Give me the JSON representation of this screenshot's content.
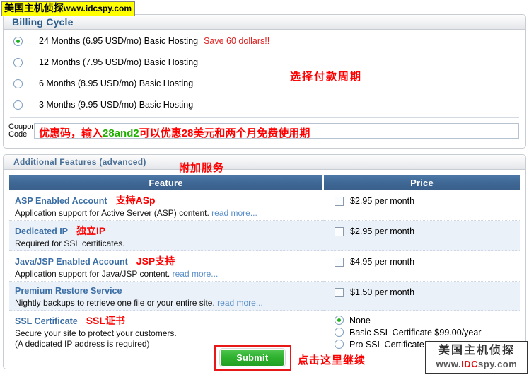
{
  "watermarks": {
    "top": {
      "cn": "美国主机侦探",
      "url": "www.idcspy.com"
    },
    "bottom": {
      "cn": "美国主机侦探",
      "url_www": "www.",
      "url_idc": "IDC",
      "url_spy": "spy.com"
    }
  },
  "billing": {
    "section_title": "Billing Cycle",
    "annotation": "选择付款周期",
    "options": [
      {
        "label": "24 Months (6.95 USD/mo) Basic Hosting",
        "note": "Save 60 dollars!!",
        "selected": true
      },
      {
        "label": "12 Months (7.95 USD/mo) Basic Hosting",
        "note": "",
        "selected": false
      },
      {
        "label": "6 Months (8.95 USD/mo) Basic Hosting",
        "note": "",
        "selected": false
      },
      {
        "label": "3 Months (9.95 USD/mo) Basic Hosting",
        "note": "",
        "selected": false
      }
    ],
    "coupon": {
      "label_line1": "Coupon",
      "label_line2": "Code",
      "value_pre": "优惠码，输入",
      "value_code": "28and2",
      "value_post": "可以优惠28美元和两个月免费使用期",
      "placeholder": ""
    }
  },
  "features": {
    "section_title": "Additional Features (advanced)",
    "annotation": "附加服务",
    "columns": {
      "feature": "Feature",
      "price": "Price"
    },
    "rows": [
      {
        "name": "ASP Enabled Account",
        "cn": "支持ASp",
        "desc": "Application support for Active Server (ASP) content.",
        "readmore": "read more...",
        "price": "$2.95 per month",
        "control": "checkbox",
        "checked": false
      },
      {
        "name": "Dedicated IP",
        "cn": "独立IP",
        "desc": "Required for SSL certificates.",
        "readmore": "",
        "price": "$2.95 per month",
        "control": "checkbox",
        "checked": false
      },
      {
        "name": "Java/JSP Enabled Account",
        "cn": "JSP支持",
        "desc": "Application support for Java/JSP content.",
        "readmore": "read more...",
        "price": "$4.95 per month",
        "control": "checkbox",
        "checked": false
      },
      {
        "name": "Premium Restore Service",
        "cn": "",
        "desc": "Nightly backups to retrieve one file or your entire site.",
        "readmore": "read more...",
        "price": "$1.50 per month",
        "control": "checkbox",
        "checked": false
      }
    ],
    "ssl": {
      "name": "SSL Certificate",
      "cn": "SSL证书",
      "desc_line1": "Secure your site to protect your customers.",
      "desc_line2": "(A dedicated IP address is required)",
      "options": [
        {
          "label": "None",
          "selected": true
        },
        {
          "label": "Basic SSL Certificate $99.00/year",
          "selected": false
        },
        {
          "label": "Pro SSL Certificate $119.00/year",
          "selected": false
        }
      ]
    }
  },
  "submit": {
    "label": "Submit",
    "annotation": "点击这里继续"
  },
  "colors": {
    "header_blue": "#3f6896",
    "link_blue": "#3a6ea5",
    "annotation_red": "#ff0000",
    "coupon_code_green": "#22b000",
    "submit_green": "#2eb12e",
    "highlight_yellow": "#ffff00"
  }
}
